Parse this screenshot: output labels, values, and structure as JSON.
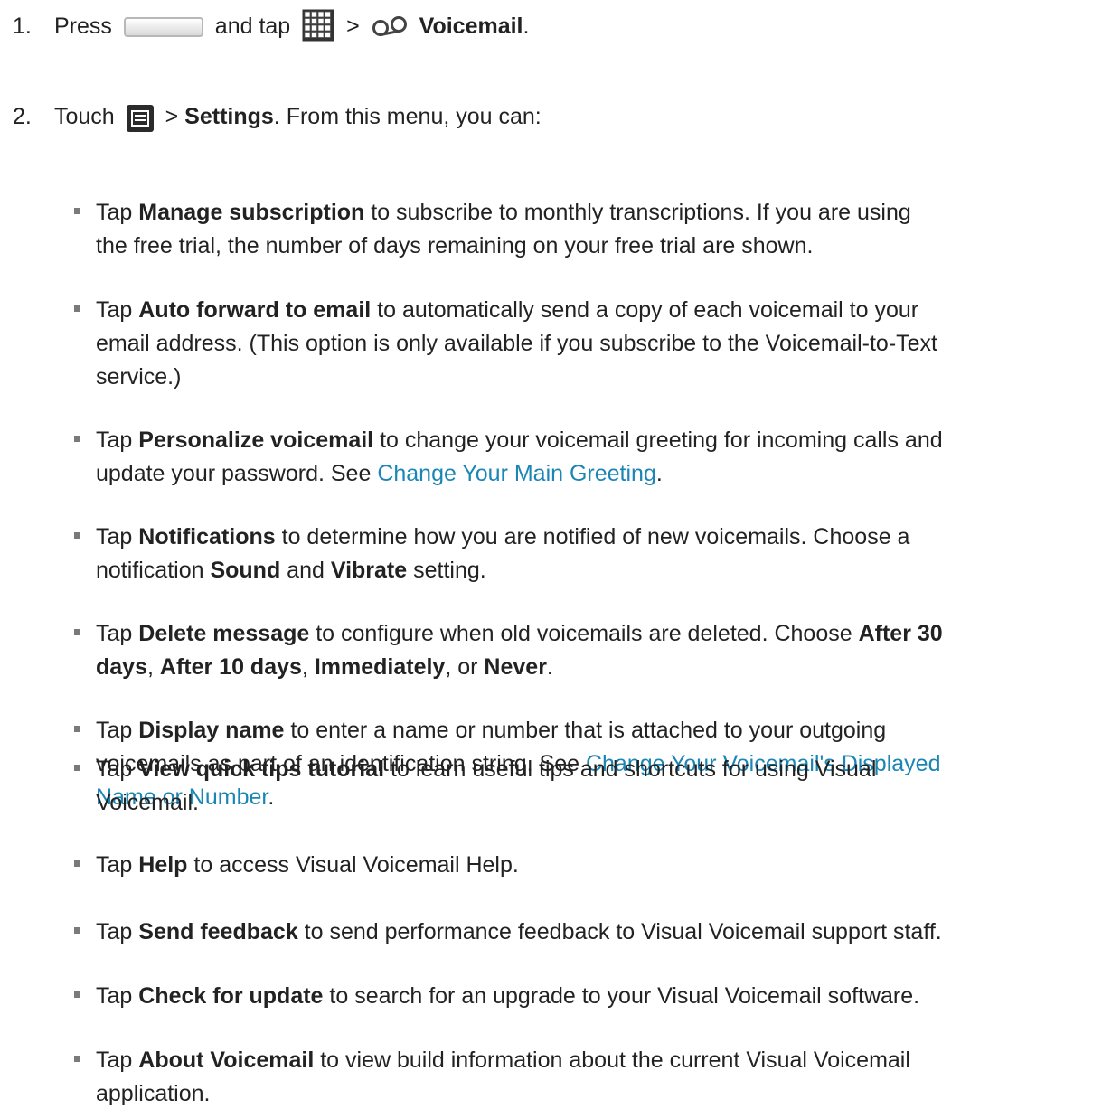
{
  "steps": [
    {
      "number": "1.",
      "segments": [
        {
          "text": "Press "
        },
        {
          "icon": "home-key-icon"
        },
        {
          "text": " and tap "
        },
        {
          "icon": "apps-grid-icon"
        },
        {
          "text": " > "
        },
        {
          "icon": "voicemail-icon"
        },
        {
          "text": " "
        },
        {
          "text": "Voicemail",
          "bold": true
        },
        {
          "text": "."
        }
      ]
    },
    {
      "number": "2.",
      "segments": [
        {
          "text": "Touch "
        },
        {
          "icon": "menu-key-icon"
        },
        {
          "text": " > "
        },
        {
          "text": "Settings",
          "bold": true
        },
        {
          "text": ". From this menu, you can:"
        }
      ]
    }
  ],
  "bullets": [
    {
      "runs": [
        {
          "text": "Tap "
        },
        {
          "text": "Manage subscription",
          "bold": true
        },
        {
          "text": " to subscribe to monthly transcriptions. If you are using\nthe free trial, the number of days remaining on your free trial are shown."
        }
      ]
    },
    {
      "runs": [
        {
          "text": "Tap "
        },
        {
          "text": "Auto forward to email",
          "bold": true
        },
        {
          "text": " to automatically send a copy of each voicemail to your\nemail address. (This option is only available if you subscribe to the Voicemail-to-Text\nservice.)"
        }
      ]
    },
    {
      "runs": [
        {
          "text": "Tap "
        },
        {
          "text": "Personalize voicemail",
          "bold": true
        },
        {
          "text": " to change your voicemail greeting for incoming calls and\nupdate your password. See "
        },
        {
          "text": "Change Your Main Greeting",
          "link": true
        },
        {
          "text": "."
        }
      ]
    },
    {
      "runs": [
        {
          "text": "Tap "
        },
        {
          "text": "Notifications",
          "bold": true
        },
        {
          "text": " to determine how you are notified of new voicemails. Choose a\nnotification "
        },
        {
          "text": "Sound",
          "bold": true
        },
        {
          "text": " and "
        },
        {
          "text": "Vibrate",
          "bold": true
        },
        {
          "text": " setting."
        }
      ]
    },
    {
      "runs": [
        {
          "text": "Tap "
        },
        {
          "text": "Delete message",
          "bold": true
        },
        {
          "text": " to configure when old voicemails are deleted. Choose "
        },
        {
          "text": "After 30\ndays",
          "bold": true
        },
        {
          "text": ", "
        },
        {
          "text": "After 10 days",
          "bold": true
        },
        {
          "text": ", "
        },
        {
          "text": "Immediately",
          "bold": true
        },
        {
          "text": ", or "
        },
        {
          "text": "Never",
          "bold": true
        },
        {
          "text": "."
        }
      ]
    },
    {
      "runs": [
        {
          "text": "Tap "
        },
        {
          "text": "Display name",
          "bold": true
        },
        {
          "text": " to enter a name or number that is attached to your outgoing\nvoicemails as part of an identification string. See "
        },
        {
          "text": "Change Your Voicemail's Displayed\nName or Number",
          "link": true
        },
        {
          "text": "."
        }
      ]
    },
    {
      "runs": [
        {
          "text": "Tap "
        },
        {
          "text": "View quick tips tutorial",
          "bold": true
        },
        {
          "text": " to learn useful tips and shortcuts for using Visual\nVoicemail."
        }
      ]
    },
    {
      "runs": [
        {
          "text": "Tap "
        },
        {
          "text": "Help",
          "bold": true
        },
        {
          "text": " to access Visual Voicemail Help."
        }
      ]
    },
    {
      "runs": [
        {
          "text": "Tap "
        },
        {
          "text": "Send feedback",
          "bold": true
        },
        {
          "text": " to send performance feedback to Visual Voicemail support staff."
        }
      ]
    },
    {
      "runs": [
        {
          "text": "Tap "
        },
        {
          "text": "Check for update",
          "bold": true
        },
        {
          "text": " to search for an upgrade to your Visual Voicemail software."
        }
      ]
    },
    {
      "runs": [
        {
          "text": "Tap "
        },
        {
          "text": "About Voicemail",
          "bold": true
        },
        {
          "text": " to view build information about the current Visual Voicemail\napplication."
        }
      ]
    }
  ],
  "colors": {
    "text": "#222222",
    "link": "#1b86b5",
    "bullet": "#7a7a7a"
  }
}
